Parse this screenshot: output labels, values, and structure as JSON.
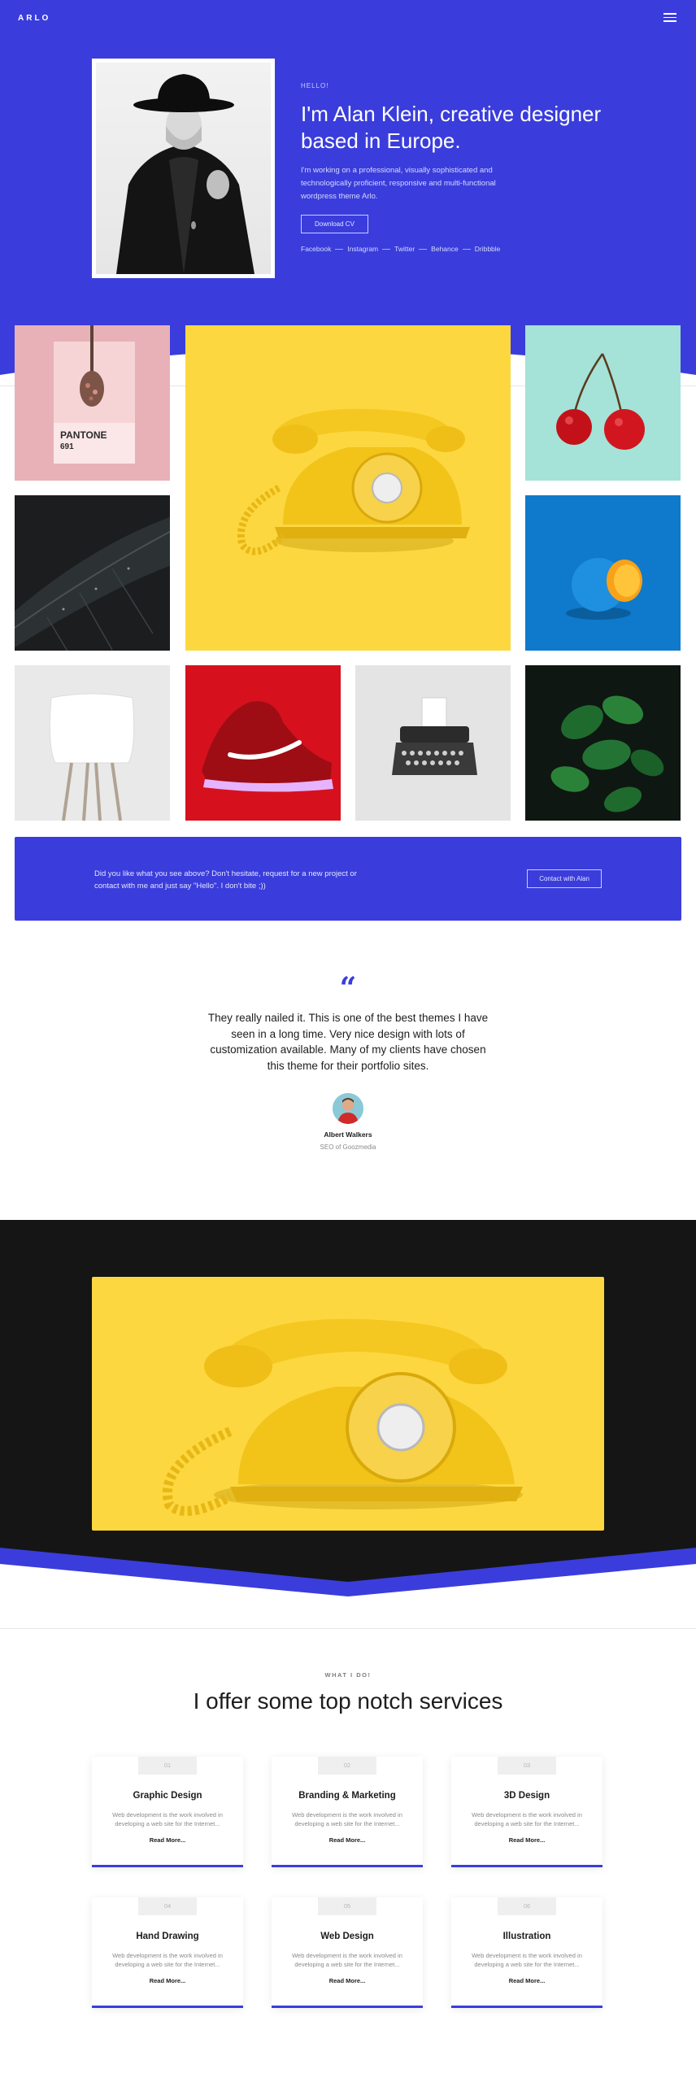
{
  "header": {
    "logo": "ARLO"
  },
  "hero": {
    "hello": "HELLO!",
    "title": "I'm Alan Klein, creative designer based in Europe.",
    "description": "I'm working on a professional, visually sophisticated and technologically proficient, responsive and multi-functional wordpress theme Arlo.",
    "cv_button": "Download CV",
    "socials": [
      "Facebook",
      "Instagram",
      "Twitter",
      "Behance",
      "Dribbble"
    ]
  },
  "gallery": {
    "pantone_label": "PANTONE",
    "pantone_number": "691"
  },
  "cta": {
    "text": "Did you like what you see above? Don't hesitate, request for a new project or contact with me and just say \"Hello\". I don't bite ;))",
    "button": "Contact with Alan"
  },
  "testimonial": {
    "quote_mark": "“",
    "text": "They really nailed it. This is one of the best themes I have seen in a long time. Very nice design with lots of customization available. Many of my clients have chosen this theme for their portfolio sites.",
    "author": "Albert Walkers",
    "role": "SEO of Goozmedia"
  },
  "services": {
    "eyebrow": "WHAT I DO!",
    "title": "I offer some top notch services",
    "items": [
      {
        "num": "01",
        "title": "Graphic Design",
        "desc": "Web development is the work involved in developing a web site for the Internet...",
        "more": "Read More..."
      },
      {
        "num": "02",
        "title": "Branding & Marketing",
        "desc": "Web development is the work involved in developing a web site for the Internet...",
        "more": "Read More..."
      },
      {
        "num": "03",
        "title": "3D Design",
        "desc": "Web development is the work involved in developing a web site for the Internet...",
        "more": "Read More..."
      },
      {
        "num": "04",
        "title": "Hand Drawing",
        "desc": "Web development is the work involved in developing a web site for the Internet...",
        "more": "Read More..."
      },
      {
        "num": "05",
        "title": "Web Design",
        "desc": "Web development is the work involved in developing a web site for the Internet...",
        "more": "Read More..."
      },
      {
        "num": "06",
        "title": "Illustration",
        "desc": "Web development is the work involved in developing a web site for the Internet...",
        "more": "Read More..."
      }
    ]
  },
  "colors": {
    "accent": "#3a3ddb",
    "dark": "#151515",
    "yellow": "#fdd740"
  }
}
